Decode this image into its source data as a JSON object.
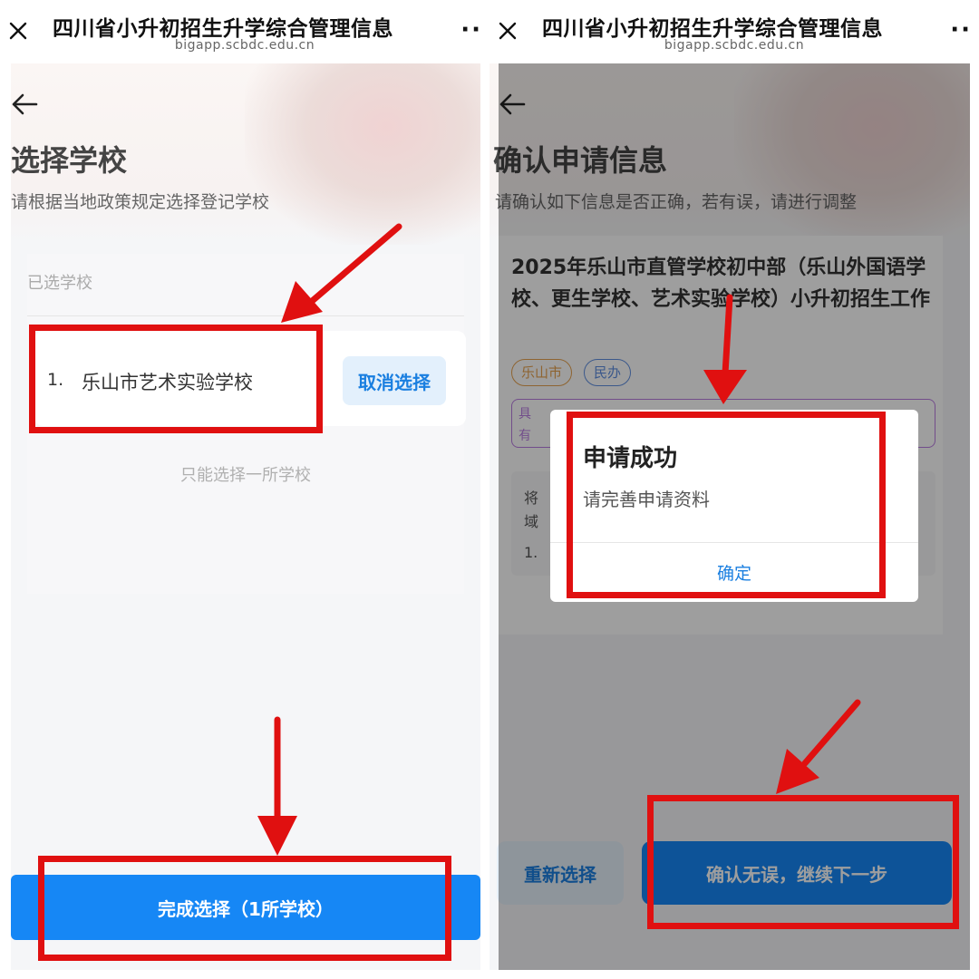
{
  "browser": {
    "title": "四川省小升初招生升学综合管理信息",
    "url": "bigapp.scbdc.edu.cn"
  },
  "left": {
    "page_title": "选择学校",
    "subtitle": "请根据当地政策规定选择登记学校",
    "selected_label": "已选学校",
    "school": {
      "index": "1.",
      "name": "乐山市艺术实验学校"
    },
    "cancel_label": "取消选择",
    "limit_note": "只能选择一所学校",
    "finish_label": "完成选择（1所学校）"
  },
  "right": {
    "page_title": "确认申请信息",
    "subtitle": "请确认如下信息是否正确，若有误，请进行调整",
    "project_title": "2025年乐山市直管学校初中部（乐山外国语学校、更生学校、艺术实验学校）小升初招生工作",
    "tags": [
      "乐山市",
      "民办"
    ],
    "purple_partial_1": "具",
    "purple_partial_2": "有",
    "region_partial_1": "将",
    "region_partial_2": "域",
    "region_partial_3": "1.",
    "reselect_label": "重新选择",
    "confirm_label": "确认无误，继续下一步",
    "dialog": {
      "title": "申请成功",
      "message": "请完善申请资料",
      "ok_label": "确定"
    }
  },
  "colors": {
    "primary": "#1687f5",
    "annotation_red": "#e01010",
    "tag_city": "#e6a24f",
    "tag_type": "#5f8fe0",
    "notice_purple": "#b97ce0"
  }
}
